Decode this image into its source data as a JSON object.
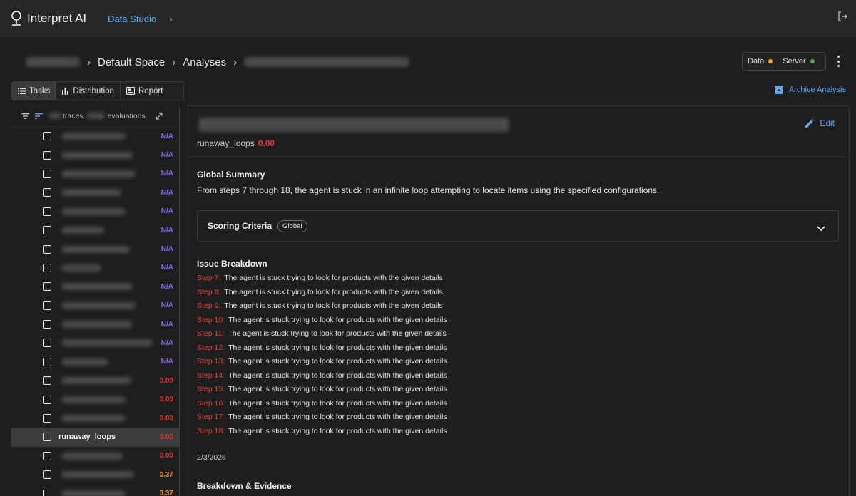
{
  "app": {
    "name": "Interpret AI",
    "nav_link": "Data Studio"
  },
  "breadcrumb": {
    "space": "Default Space",
    "section": "Analyses"
  },
  "status": {
    "data_label": "Data",
    "data_color": "#f5a623",
    "server_label": "Server",
    "server_color": "#4caf50"
  },
  "tabs": [
    {
      "label": "Tasks",
      "icon": "list-icon",
      "active": true
    },
    {
      "label": "Distribution",
      "icon": "bar-chart-icon",
      "active": false
    },
    {
      "label": "Report",
      "icon": "report-icon",
      "active": false
    }
  ],
  "archive_label": "Archive Analysis",
  "sidebar": {
    "header_traces": "traces",
    "header_evaluations": "evaluations",
    "items": [
      {
        "name": "",
        "score": "N/A",
        "color": "#8b6cf6",
        "blur_w": 90
      },
      {
        "name": "",
        "score": "N/A",
        "color": "#8b6cf6",
        "blur_w": 100
      },
      {
        "name": "",
        "score": "N/A",
        "color": "#8b6cf6",
        "blur_w": 104
      },
      {
        "name": "",
        "score": "N/A",
        "color": "#8b6cf6",
        "blur_w": 84
      },
      {
        "name": "",
        "score": "N/A",
        "color": "#8b6cf6",
        "blur_w": 90
      },
      {
        "name": "",
        "score": "N/A",
        "color": "#8b6cf6",
        "blur_w": 60
      },
      {
        "name": "",
        "score": "N/A",
        "color": "#8b6cf6",
        "blur_w": 96
      },
      {
        "name": "",
        "score": "N/A",
        "color": "#8b6cf6",
        "blur_w": 56
      },
      {
        "name": "",
        "score": "N/A",
        "color": "#8b6cf6",
        "blur_w": 100
      },
      {
        "name": "",
        "score": "N/A",
        "color": "#8b6cf6",
        "blur_w": 104
      },
      {
        "name": "",
        "score": "N/A",
        "color": "#8b6cf6",
        "blur_w": 100
      },
      {
        "name": "",
        "score": "N/A",
        "color": "#8b6cf6",
        "blur_w": 128
      },
      {
        "name": "",
        "score": "N/A",
        "color": "#8b6cf6",
        "blur_w": 66
      },
      {
        "name": "",
        "score": "0.00",
        "color": "#e53935",
        "blur_w": 98
      },
      {
        "name": "",
        "score": "0.00",
        "color": "#e53935",
        "blur_w": 90
      },
      {
        "name": "",
        "score": "0.00",
        "color": "#e53935",
        "blur_w": 90
      },
      {
        "name": "runaway_loops",
        "score": "0.00",
        "color": "#e53935",
        "blur_w": 0,
        "selected": true
      },
      {
        "name": "",
        "score": "0.00",
        "color": "#e53935",
        "blur_w": 86
      },
      {
        "name": "",
        "score": "0.37",
        "color": "#f08c2a",
        "blur_w": 102
      },
      {
        "name": "",
        "score": "0.37",
        "color": "#f08c2a",
        "blur_w": 90
      }
    ]
  },
  "detail": {
    "metric_name": "runaway_loops",
    "metric_value": "0.00",
    "edit_label": "Edit",
    "global_summary_title": "Global Summary",
    "global_summary_text": "From steps 7 through 18, the agent is stuck in an infinite loop attempting to locate items using the specified configurations.",
    "scoring_criteria_label": "Scoring Criteria",
    "scoring_criteria_pill": "Global",
    "issue_breakdown_title": "Issue Breakdown",
    "issues": [
      {
        "step": "Step 7:",
        "text": "The agent is stuck trying to look for products with the given details"
      },
      {
        "step": "Step 8:",
        "text": "The agent is stuck trying to look for products with the given details"
      },
      {
        "step": "Step 9:",
        "text": "The agent is stuck trying to look for products with the given details"
      },
      {
        "step": "Step 10:",
        "text": "The agent is stuck trying to look for products with the given details"
      },
      {
        "step": "Step 11:",
        "text": "The agent is stuck trying to look for products with the given details"
      },
      {
        "step": "Step 12:",
        "text": "The agent is stuck trying to look for products with the given details"
      },
      {
        "step": "Step 13:",
        "text": "The agent is stuck trying to look for products with the given details"
      },
      {
        "step": "Step 14:",
        "text": "The agent is stuck trying to look for products with the given details"
      },
      {
        "step": "Step 15:",
        "text": "The agent is stuck trying to look for products with the given details"
      },
      {
        "step": "Step 16:",
        "text": "The agent is stuck trying to look for products with the given details"
      },
      {
        "step": "Step 17:",
        "text": "The agent is stuck trying to look for products with the given details"
      },
      {
        "step": "Step 18:",
        "text": "The agent is stuck trying to look for products with the given details"
      }
    ],
    "date": "2/3/2026",
    "breakdown_evidence_title": "Breakdown & Evidence"
  }
}
